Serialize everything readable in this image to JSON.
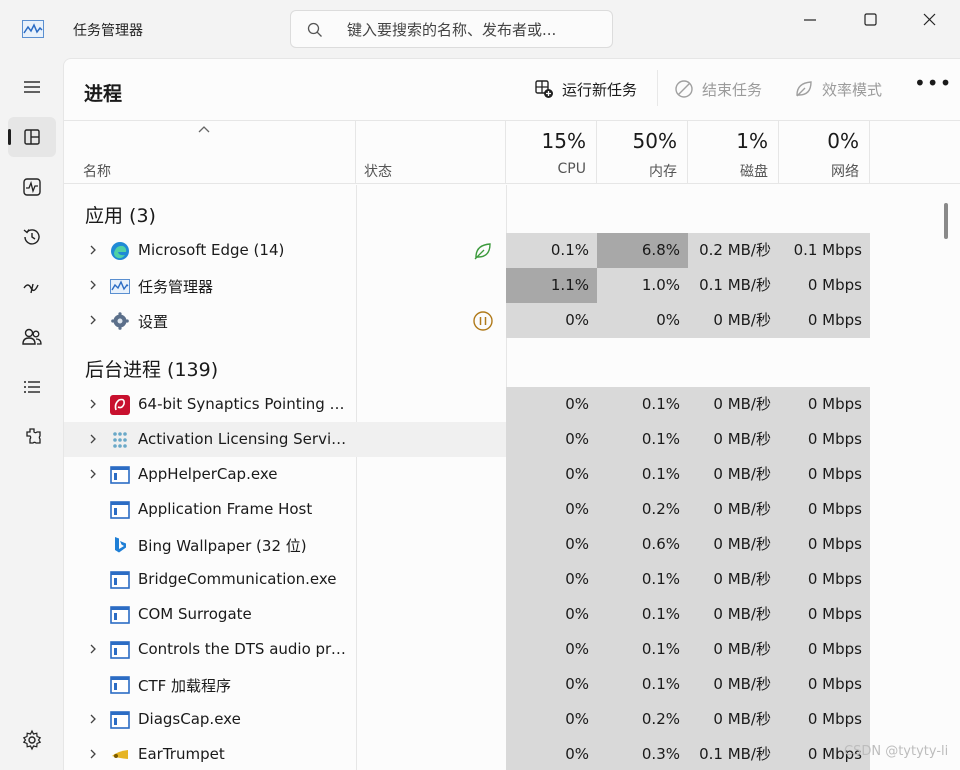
{
  "window": {
    "title": "任务管理器",
    "search_placeholder": "键入要搜索的名称、发布者或..."
  },
  "nav": {
    "items": [
      {
        "icon": "hamburger-icon"
      },
      {
        "icon": "processes-icon",
        "active": true
      },
      {
        "icon": "performance-icon"
      },
      {
        "icon": "app-history-icon"
      },
      {
        "icon": "startup-icon"
      },
      {
        "icon": "users-icon"
      },
      {
        "icon": "details-icon"
      },
      {
        "icon": "services-icon"
      }
    ],
    "settings_icon": "gear-icon"
  },
  "page": {
    "title": "进程",
    "toolbar": {
      "run_task": "运行新任务",
      "end_task": "结束任务",
      "efficiency_mode": "效率模式",
      "more": "•••"
    }
  },
  "header": {
    "name": "名称",
    "status": "状态",
    "cpu": {
      "pct": "15%",
      "label": "CPU"
    },
    "memory": {
      "pct": "50%",
      "label": "内存"
    },
    "disk": {
      "pct": "1%",
      "label": "磁盘"
    },
    "network": {
      "pct": "0%",
      "label": "网络"
    }
  },
  "sections": {
    "apps": "应用 (3)",
    "background": "后台进程 (139)"
  },
  "apps": [
    {
      "name": "Microsoft Edge (14)",
      "cpu": "0.1%",
      "mem": "6.8%",
      "disk": "0.2 MB/秒",
      "net": "0.1 Mbps"
    },
    {
      "name": "任务管理器",
      "cpu": "1.1%",
      "mem": "1.0%",
      "disk": "0.1 MB/秒",
      "net": "0 Mbps"
    },
    {
      "name": "设置",
      "cpu": "0%",
      "mem": "0%",
      "disk": "0 MB/秒",
      "net": "0 Mbps"
    }
  ],
  "background": [
    {
      "name": "64-bit Synaptics Pointing E...",
      "cpu": "0%",
      "mem": "0.1%",
      "disk": "0 MB/秒",
      "net": "0 Mbps"
    },
    {
      "name": "Activation Licensing Servic...",
      "cpu": "0%",
      "mem": "0.1%",
      "disk": "0 MB/秒",
      "net": "0 Mbps"
    },
    {
      "name": "AppHelperCap.exe",
      "cpu": "0%",
      "mem": "0.1%",
      "disk": "0 MB/秒",
      "net": "0 Mbps"
    },
    {
      "name": "Application Frame Host",
      "cpu": "0%",
      "mem": "0.2%",
      "disk": "0 MB/秒",
      "net": "0 Mbps"
    },
    {
      "name": "Bing Wallpaper (32 位)",
      "cpu": "0%",
      "mem": "0.6%",
      "disk": "0 MB/秒",
      "net": "0 Mbps"
    },
    {
      "name": "BridgeCommunication.exe",
      "cpu": "0%",
      "mem": "0.1%",
      "disk": "0 MB/秒",
      "net": "0 Mbps"
    },
    {
      "name": "COM Surrogate",
      "cpu": "0%",
      "mem": "0.1%",
      "disk": "0 MB/秒",
      "net": "0 Mbps"
    },
    {
      "name": "Controls the DTS audio pro...",
      "cpu": "0%",
      "mem": "0.1%",
      "disk": "0 MB/秒",
      "net": "0 Mbps"
    },
    {
      "name": "CTF 加载程序",
      "cpu": "0%",
      "mem": "0.1%",
      "disk": "0 MB/秒",
      "net": "0 Mbps"
    },
    {
      "name": "DiagsCap.exe",
      "cpu": "0%",
      "mem": "0.2%",
      "disk": "0 MB/秒",
      "net": "0 Mbps"
    },
    {
      "name": "EarTrumpet",
      "cpu": "0%",
      "mem": "0.3%",
      "disk": "0.1 MB/秒",
      "net": "0 Mbps"
    }
  ],
  "colors": {
    "heat_low": "#d9d9d9",
    "heat_mid": "#b4b4b4",
    "heat_high": "#a8a8a8",
    "efficiency_green": "#3c9a3c",
    "paused_amber": "#b07a1a"
  },
  "watermark": "CSDN @tytyty-li"
}
